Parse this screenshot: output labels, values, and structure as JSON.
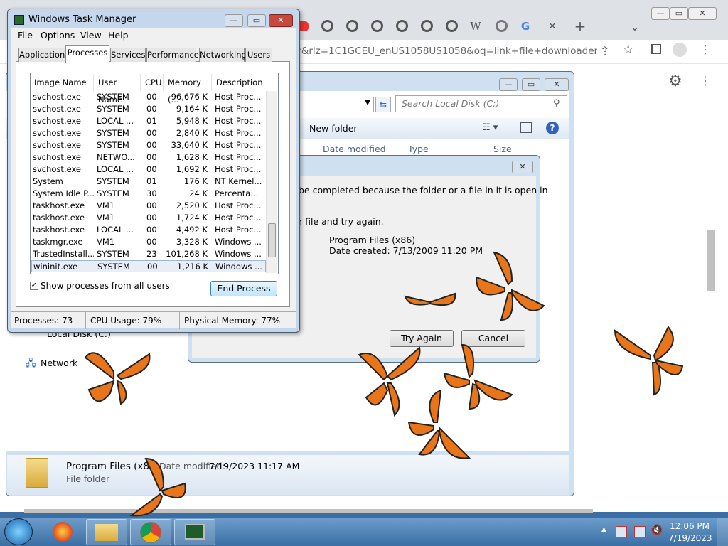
{
  "chrome": {
    "omnibox_text": "er&rlz=1C1GCEU_enUS1058US1058&oq=link+file+downloader&...",
    "tab_icons": [
      "youtube-icon",
      "chrome-icon",
      "chrome-icon",
      "chrome-icon",
      "chrome-icon",
      "chrome-icon",
      "chrome-icon",
      "wikipedia-icon",
      "globe-icon",
      "google-icon"
    ],
    "wiki_label": "W",
    "google_label": "G",
    "new_tab": "+",
    "close_tab": "✕",
    "dropdown": "⌄"
  },
  "explorer": {
    "search_placeholder": "Search Local Disk (C:)",
    "new_folder": "New folder",
    "columns": [
      "Date modified",
      "Type",
      "Size"
    ],
    "nav": {
      "local_disk": "Local Disk (C:)",
      "network": "Network"
    },
    "details": {
      "name": "Program Files (x86)",
      "date_label": "Date modified:",
      "date": "7/19/2023 11:17 AM",
      "type": "File folder"
    }
  },
  "dialog": {
    "line1": "be completed because the folder or a file in it is open in",
    "line2": "r file and try again.",
    "item_name": "Program Files (x86)",
    "item_date": "Date created: 7/13/2009 11:20 PM",
    "try_again": "Try Again",
    "cancel": "Cancel"
  },
  "taskmanager": {
    "title": "Windows Task Manager",
    "menus": [
      "File",
      "Options",
      "View",
      "Help"
    ],
    "tabs": [
      "Applications",
      "Processes",
      "Services",
      "Performance",
      "Networking",
      "Users"
    ],
    "active_tab": "Processes",
    "columns": [
      "Image Name",
      "User Name",
      "CPU",
      "Memory (...",
      "Description"
    ],
    "rows": [
      [
        "svchost.exe",
        "SYSTEM",
        "00",
        "96,676 K",
        "Host Proc..."
      ],
      [
        "svchost.exe",
        "SYSTEM",
        "00",
        "9,164 K",
        "Host Proc..."
      ],
      [
        "svchost.exe",
        "LOCAL ...",
        "01",
        "5,948 K",
        "Host Proc..."
      ],
      [
        "svchost.exe",
        "SYSTEM",
        "00",
        "2,840 K",
        "Host Proc..."
      ],
      [
        "svchost.exe",
        "SYSTEM",
        "00",
        "33,640 K",
        "Host Proc..."
      ],
      [
        "svchost.exe",
        "NETWO...",
        "00",
        "1,628 K",
        "Host Proc..."
      ],
      [
        "svchost.exe",
        "LOCAL ...",
        "00",
        "1,692 K",
        "Host Proc..."
      ],
      [
        "System",
        "SYSTEM",
        "01",
        "176 K",
        "NT Kernel..."
      ],
      [
        "System Idle P...",
        "SYSTEM",
        "30",
        "24 K",
        "Percenta..."
      ],
      [
        "taskhost.exe",
        "VM1",
        "00",
        "2,520 K",
        "Host Proc..."
      ],
      [
        "taskhost.exe",
        "VM1",
        "00",
        "1,724 K",
        "Host Proc..."
      ],
      [
        "taskhost.exe",
        "LOCAL ...",
        "00",
        "4,492 K",
        "Host Proc..."
      ],
      [
        "taskmgr.exe",
        "VM1",
        "00",
        "3,328 K",
        "Windows ..."
      ],
      [
        "TrustedInstall...",
        "SYSTEM",
        "23",
        "101,268 K",
        "Windows ..."
      ],
      [
        "wininit.exe",
        "SYSTEM",
        "00",
        "1,216 K",
        "Windows ..."
      ]
    ],
    "show_all": "Show processes from all users",
    "end_process": "End Process",
    "status": {
      "processes": "Processes: 73",
      "cpu": "CPU Usage: 79%",
      "memory": "Physical Memory: 77%"
    }
  },
  "taskbar": {
    "time": "12:06 PM",
    "date": "7/19/2023",
    "tray_arrow": "▲"
  },
  "colors": {
    "butterfly": "#e8751a",
    "desktop": "#3a6ea5"
  }
}
